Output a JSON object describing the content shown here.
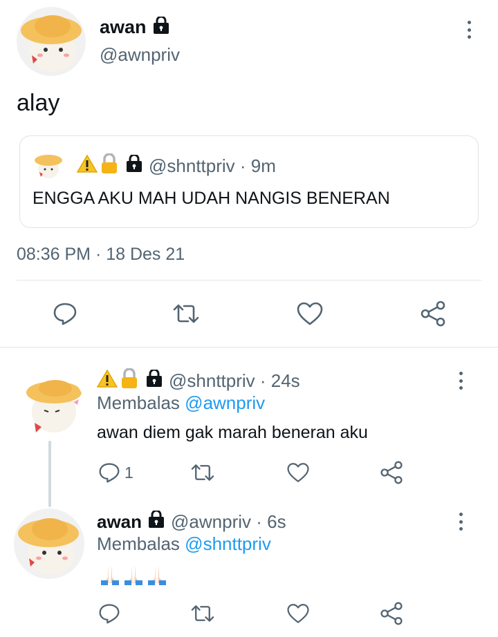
{
  "main_tweet": {
    "author_name": "awan",
    "author_handle": "@awnpriv",
    "text": "alay",
    "timestamp": "08:36 PM · 18 Des 21",
    "quoted": {
      "handle_meta": "@shnttpriv · 9m",
      "text": "ENGGA AKU MAH UDAH NANGIS BENERAN"
    }
  },
  "replies": [
    {
      "handle_meta": "@shnttpriv · 24s",
      "replying_prefix": "Membalas",
      "replying_to": "@awnpriv",
      "text": "awan diem gak marah beneran aku",
      "reply_count": "1"
    },
    {
      "author_name": "awan",
      "handle_meta": "@awnpriv · 6s",
      "replying_prefix": "Membalas",
      "replying_to": "@shnttpriv",
      "emoji_count": 3
    }
  ],
  "icons": [
    "lock-icon",
    "warning-icon",
    "padlock-emoji",
    "more-icon",
    "reply-icon",
    "retweet-icon",
    "like-icon",
    "share-icon",
    "pray-emoji"
  ],
  "colors": {
    "accent": "#1d9bf0",
    "muted": "#536471",
    "border": "#dfe3e6"
  }
}
